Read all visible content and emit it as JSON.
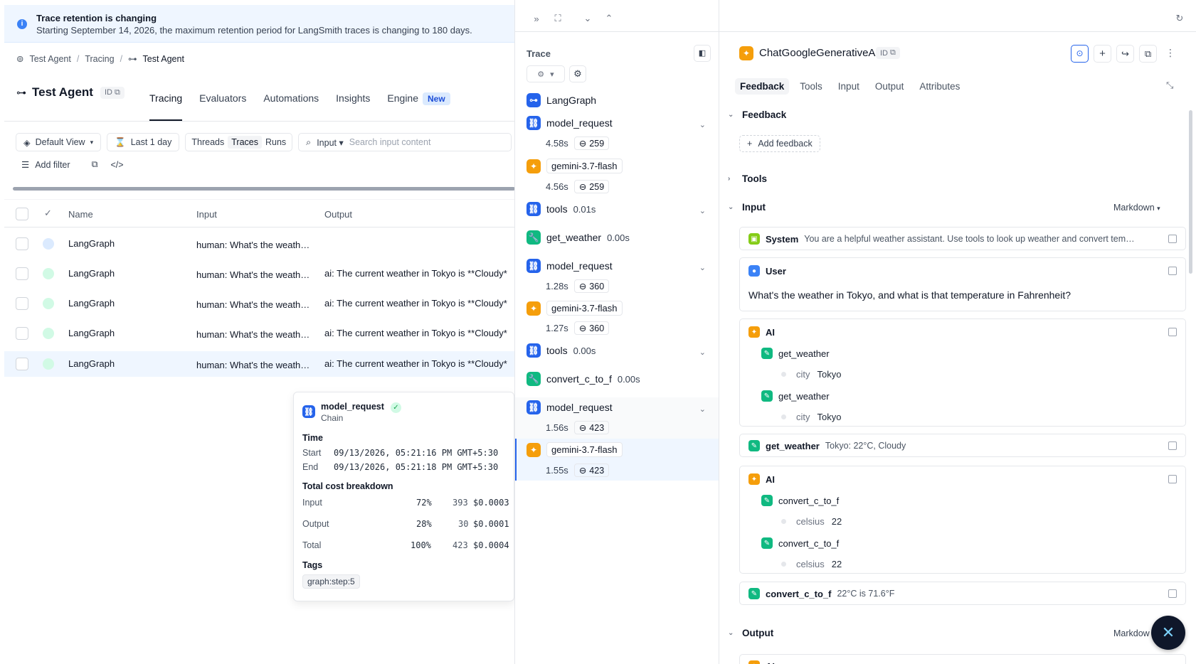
{
  "banner": {
    "title": "Trace retention is changing",
    "body": "Starting September 14, 2026, the maximum retention period for LangSmith traces is changing to 180 days."
  },
  "breadcrumb": [
    "Test Agent",
    "Tracing",
    "Test Agent"
  ],
  "project": {
    "title": "Test Agent",
    "id_label": "ID",
    "tabs": [
      "Tracing",
      "Evaluators",
      "Automations",
      "Insights",
      "Engine"
    ],
    "new_badge": "New"
  },
  "filters": {
    "view": "Default View",
    "time": "Last 1 day",
    "segments": [
      "Threads",
      "Traces",
      "Runs"
    ],
    "search_scope": "Input",
    "search_placeholder": "Search input content",
    "add_filter": "Add filter"
  },
  "table": {
    "columns": [
      "Name",
      "Input",
      "Output"
    ],
    "rows": [
      {
        "name": "LangGraph",
        "input": "human: What's the weath…",
        "output": ""
      },
      {
        "name": "LangGraph",
        "input": "human: What's the weath…",
        "output": "ai: The current weather in Tokyo is **Cloudy*"
      },
      {
        "name": "LangGraph",
        "input": "human: What's the weath…",
        "output": "ai: The current weather in Tokyo is **Cloudy*"
      },
      {
        "name": "LangGraph",
        "input": "human: What's the weath…",
        "output": "ai: The current weather in Tokyo is **Cloudy*"
      },
      {
        "name": "LangGraph",
        "input": "human: What's the weath…",
        "output": "ai: The current weather in Tokyo is **Cloudy*"
      }
    ]
  },
  "hover_card": {
    "name": "model_request",
    "type": "Chain",
    "time_label": "Time",
    "start_label": "Start",
    "start": "09/13/2026, 05:21:16 PM GMT+5:30",
    "end_label": "End",
    "end": "09/13/2026, 05:21:18 PM GMT+5:30",
    "cost_label": "Total cost breakdown",
    "cost_rows": [
      {
        "label": "Input",
        "pct": "72%",
        "tokens": "393",
        "cost": "$0.0003"
      },
      {
        "label": "Output",
        "pct": "28%",
        "tokens": "30",
        "cost": "$0.0001"
      },
      {
        "label": "Total",
        "pct": "100%",
        "tokens": "423",
        "cost": "$0.0004"
      }
    ],
    "tags_label": "Tags",
    "tag": "graph:step:5"
  },
  "trace": {
    "title": "Trace",
    "nodes": [
      {
        "name": "LangGraph"
      },
      {
        "name": "model_request",
        "time": "4.58s",
        "tokens": "259"
      },
      {
        "name": "gemini-3.7-flash",
        "time": "4.56s",
        "tokens": "259"
      },
      {
        "name": "tools",
        "time": "0.01s"
      },
      {
        "name": "get_weather",
        "time": "0.00s"
      },
      {
        "name": "model_request",
        "time": "1.28s",
        "tokens": "360"
      },
      {
        "name": "gemini-3.7-flash",
        "time": "1.27s",
        "tokens": "360"
      },
      {
        "name": "tools",
        "time": "0.00s"
      },
      {
        "name": "convert_c_to_f",
        "time": "0.00s"
      },
      {
        "name": "model_request",
        "time": "1.56s",
        "tokens": "423"
      },
      {
        "name": "gemini-3.7-flash",
        "time": "1.55s",
        "tokens": "423"
      }
    ]
  },
  "run": {
    "title": "ChatGoogleGenerativeAI",
    "id_label": "ID",
    "tabs": [
      "Feedback",
      "Tools",
      "Input",
      "Output",
      "Attributes"
    ],
    "feedback_label": "Feedback",
    "add_feedback": "Add feedback",
    "tools_label": "Tools",
    "input_label": "Input",
    "format": "Markdown",
    "output_label": "Output",
    "output_format": "Markdow",
    "messages": {
      "system_role": "System",
      "system_text": "You are a helpful weather assistant. Use tools to look up weather and convert tem…",
      "user_role": "User",
      "user_text": "What's the weather in Tokyo, and what is that temperature in Fahrenheit?",
      "ai_role": "AI",
      "ai1_calls": [
        {
          "name": "get_weather",
          "arg_key": "city",
          "arg_val": "Tokyo"
        },
        {
          "name": "get_weather",
          "arg_key": "city",
          "arg_val": "Tokyo"
        }
      ],
      "tool1_name": "get_weather",
      "tool1_result": "Tokyo: 22°C, Cloudy",
      "ai2_calls": [
        {
          "name": "convert_c_to_f",
          "arg_key": "celsius",
          "arg_val": "22"
        },
        {
          "name": "convert_c_to_f",
          "arg_key": "celsius",
          "arg_val": "22"
        }
      ],
      "tool2_name": "convert_c_to_f",
      "tool2_result": "22°C is 71.6°F",
      "output_role": "AI"
    }
  },
  "colors": {
    "accent": "#2563eb",
    "llm": "#f59e0b",
    "tool": "#10b981",
    "success": "#22c55e"
  }
}
